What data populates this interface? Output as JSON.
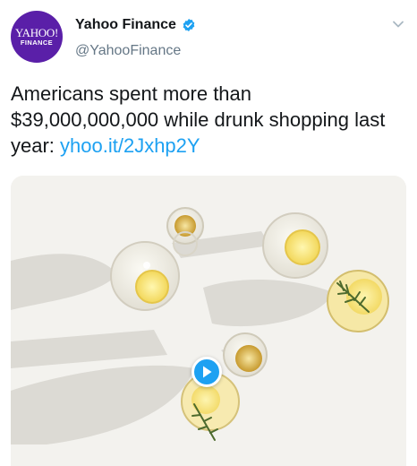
{
  "tweet": {
    "avatar": {
      "logo_top": "YAHOO!",
      "logo_bottom": "FINANCE"
    },
    "display_name": "Yahoo Finance",
    "handle": "@YahooFinance",
    "text": "Americans spent more than $39,000,000,000 while drunk shopping last year: ",
    "link": "yhoo.it/2Jxhp2Y"
  },
  "icons": {
    "verified": "verified-badge-icon",
    "caret": "chevron-down-icon",
    "play": "play-icon"
  },
  "colors": {
    "avatar_bg": "#5a1fa8",
    "link": "#1da1f2",
    "handle": "#657786",
    "play_button": "#1da1f2"
  }
}
